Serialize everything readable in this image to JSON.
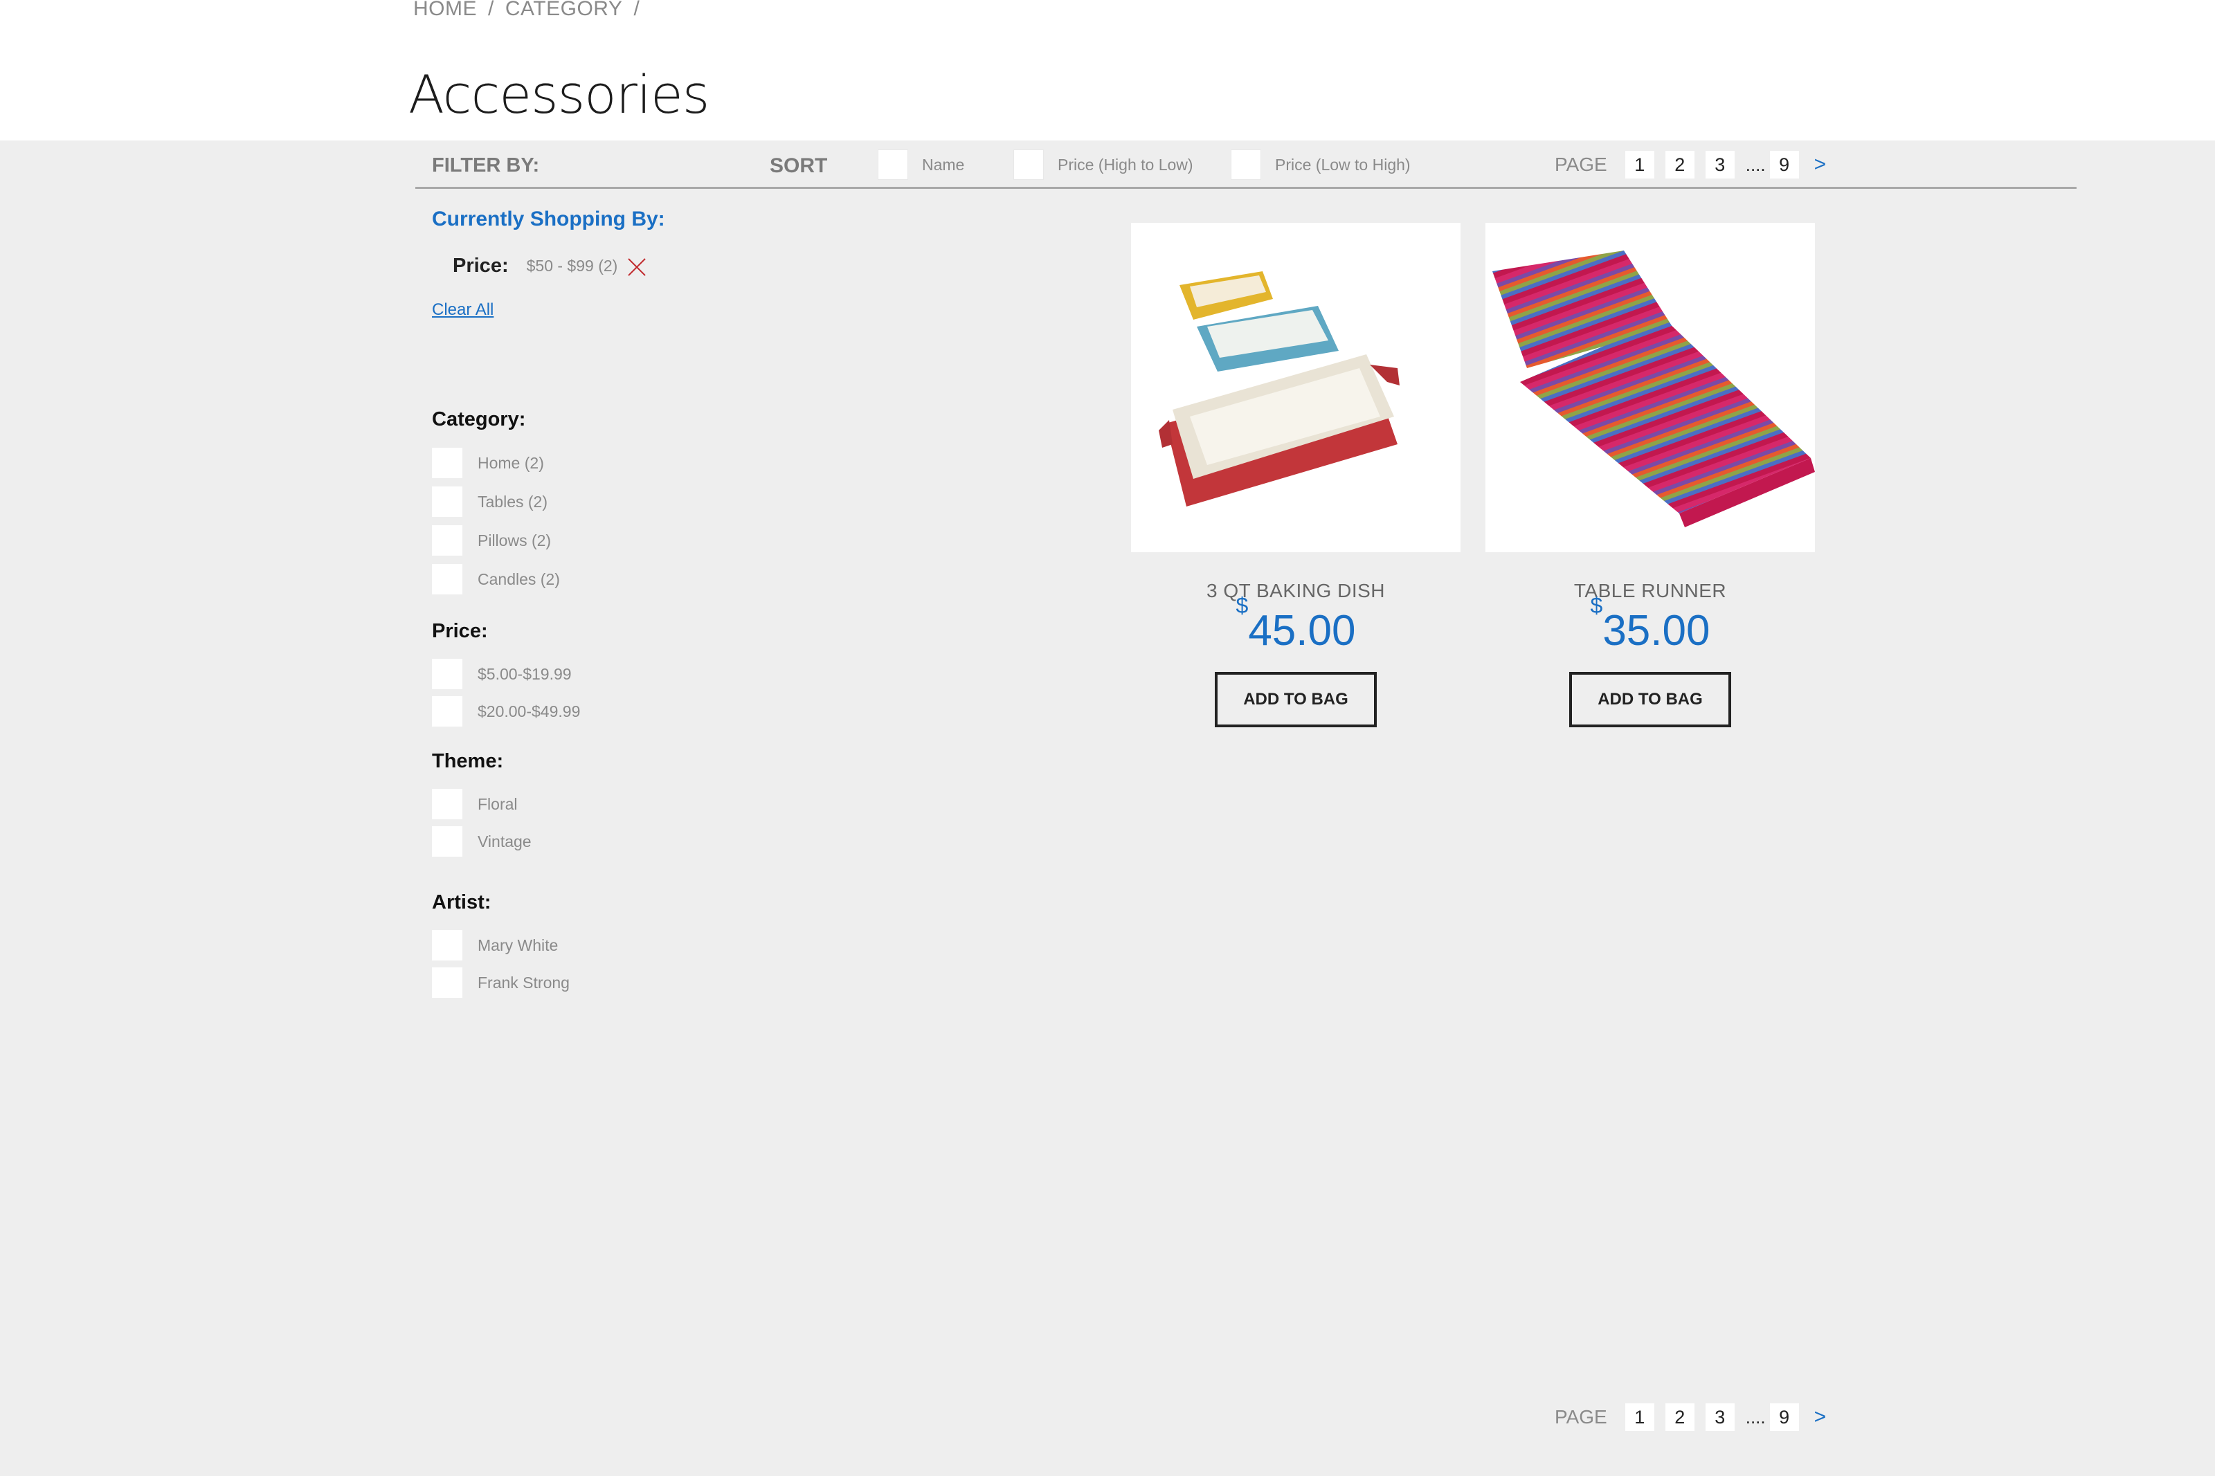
{
  "breadcrumb": [
    "HOME",
    "CATEGORY"
  ],
  "page_title": "Accessories",
  "toolbar": {
    "filter_by": "FILTER BY:",
    "sort": "SORT",
    "sort_options": [
      "Name",
      "Price (High to Low)",
      "Price (Low to High)"
    ]
  },
  "pagination": {
    "label": "PAGE",
    "pages": [
      "1",
      "2",
      "3"
    ],
    "dots": "....",
    "last": "9",
    "next": ">"
  },
  "sidebar": {
    "currently_shopping": "Currently Shopping By:",
    "applied_filter": {
      "label": "Price:",
      "value": "$50 - $99  (2)"
    },
    "clear_all": "Clear All",
    "category": {
      "title": "Category:",
      "options": [
        "Home  (2)",
        "Tables  (2)",
        "Pillows  (2)",
        "Candles (2)"
      ]
    },
    "price": {
      "title": "Price:",
      "options": [
        "$5.00-$19.99",
        "$20.00-$49.99"
      ]
    },
    "theme": {
      "title": "Theme:",
      "options": [
        "Floral",
        "Vintage"
      ]
    },
    "artist": {
      "title": "Artist:",
      "options": [
        "Mary White",
        "Frank Strong"
      ]
    }
  },
  "products": [
    {
      "name": "3 QT BAKING DISH",
      "currency": "$",
      "price": "45.00",
      "button": "ADD TO BAG"
    },
    {
      "name": "TABLE RUNNER",
      "currency": "$",
      "price": "35.00",
      "button": "ADD TO BAG"
    }
  ],
  "colors": {
    "accent": "#1a6fc4",
    "background": "#eeeeee",
    "remove": "#c0282c"
  }
}
